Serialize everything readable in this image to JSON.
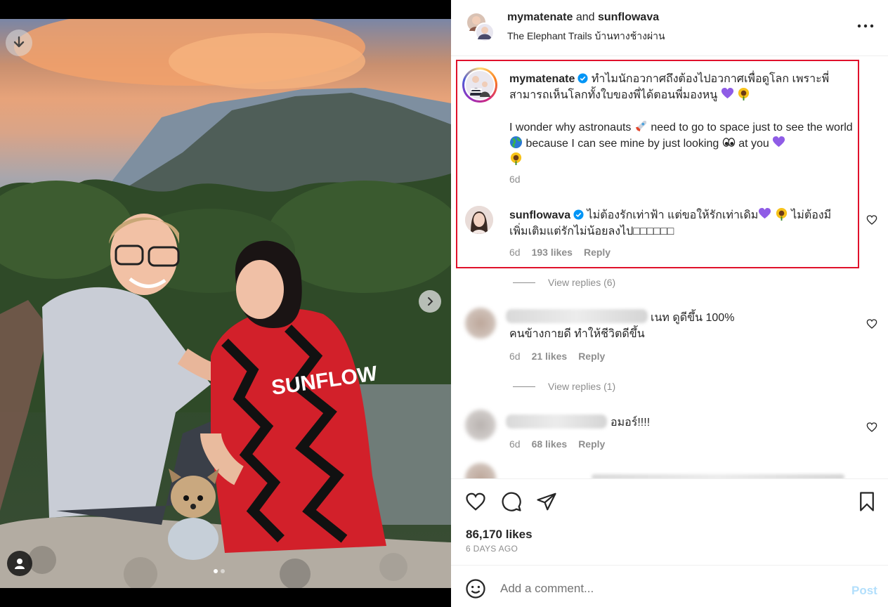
{
  "header": {
    "author": "mymatenate",
    "conjunction": "and",
    "coauthor": "sunflowava",
    "location": "The Elephant Trails บ้านทางช้างผ่าน"
  },
  "caption": {
    "username": "mymatenate",
    "text_th_1": "ทำไมนักอวกาศถึงต้องไปอวกาศเพื่อดูโลก เพราะพี่",
    "text_th_2": "สามารถเห็นโลกทั้งใบของพี่ได้ตอนพี่มองหนู",
    "text_en_1": "I wonder why astronauts",
    "text_en_2": "need to go to space just to see the",
    "text_en_3": "world",
    "text_en_4": "because I can see mine by just looking",
    "text_en_5": "at you",
    "time": "6d"
  },
  "reply": {
    "username": "sunflowava",
    "text_1": "ไม่ต้องรักเท่าฟ้า แต่ขอให้รักเท่าเดิม",
    "text_1b": "ไม่ต้องมี",
    "text_2": "เพิ่มเติมแต่รักไม่น้อยลงไป□□□□□□",
    "time": "6d",
    "likes": "193 likes",
    "reply_label": "Reply"
  },
  "view_replies_1": "View replies (6)",
  "comment_2": {
    "text_1": "เนท ดูดีขึ้น 100%",
    "text_2": "คนข้างกายดี ทำให้ชีวิตดีขึ้น",
    "time": "6d",
    "likes": "21 likes",
    "reply_label": "Reply"
  },
  "view_replies_2": "View replies (1)",
  "comment_3": {
    "text_1": "อมอร์!!!!",
    "time": "6d",
    "likes": "68 likes",
    "reply_label": "Reply"
  },
  "likes": "86,170 likes",
  "time_ago": "6 DAYS AGO",
  "composer": {
    "placeholder": "Add a comment...",
    "post_label": "Post"
  },
  "colors": {
    "highlight": "#e0112b",
    "verified": "#0095f6",
    "post_disabled": "#b2dffc"
  },
  "icons": [
    "download-icon",
    "chevron-right-icon",
    "user-tag-icon",
    "more-icon",
    "verified-icon",
    "heart-icon",
    "comment-icon",
    "share-icon",
    "bookmark-icon",
    "emoji-icon"
  ],
  "carousel": {
    "total": 2,
    "active": 1
  }
}
